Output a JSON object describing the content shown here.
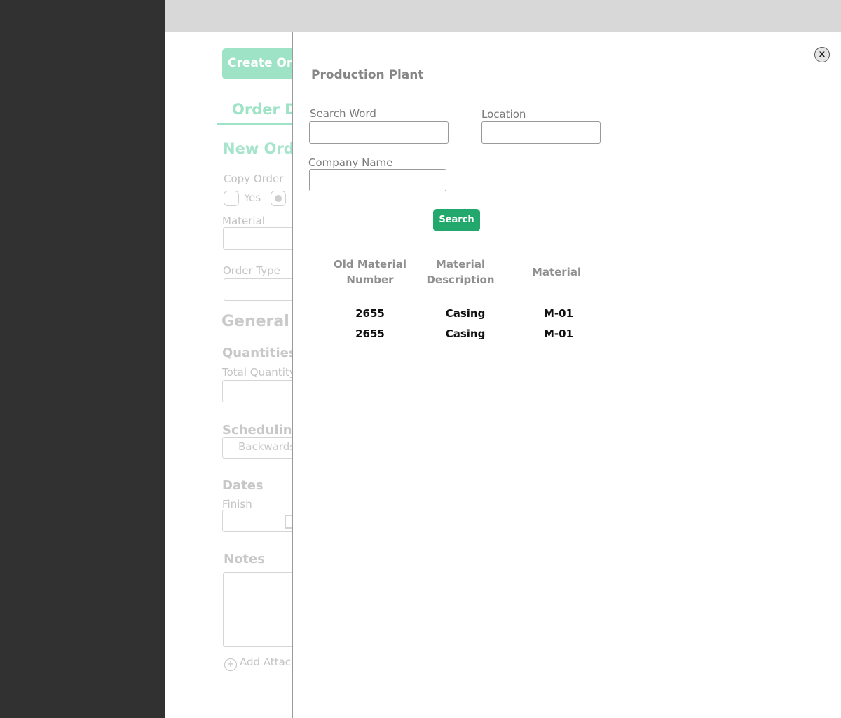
{
  "background": {
    "create_button": "Create Ord",
    "tab_label": "Order D",
    "section_title": "New Orde",
    "copy_order_label": "Copy Order",
    "yes_label": "Yes",
    "material_label": "Material",
    "order_type_label": "Order Type",
    "general_title": "General",
    "quantities_title": "Quantities",
    "total_quantity_label": "Total Quantity",
    "scheduling_title": "Scheduling",
    "scheduling_value": "Backwards",
    "dates_title": "Dates",
    "finish_label": "Finish",
    "notes_title": "Notes",
    "add_attachment_label": "Add Attach"
  },
  "modal": {
    "close_label": "x",
    "title": "Production Plant",
    "search_word_label": "Search Word",
    "search_word_value": "",
    "location_label": "Location",
    "location_value": "",
    "company_name_label": "Company Name",
    "company_name_value": "",
    "search_button": "Search",
    "table": {
      "headers": {
        "old_material_line1": "Old Material",
        "old_material_line2": "Number",
        "description_line1": "Material",
        "description_line2": "Description",
        "material": "Material"
      },
      "rows": [
        {
          "old_number": "2655",
          "description": "Casing",
          "material": "M-01"
        },
        {
          "old_number": "2655",
          "description": "Casing",
          "material": "M-01"
        }
      ]
    }
  },
  "colors": {
    "sidebar": "#313131",
    "topbar": "#d7d8d7",
    "accent_green": "#22a86c",
    "faded_green": "#9ee3c5"
  }
}
